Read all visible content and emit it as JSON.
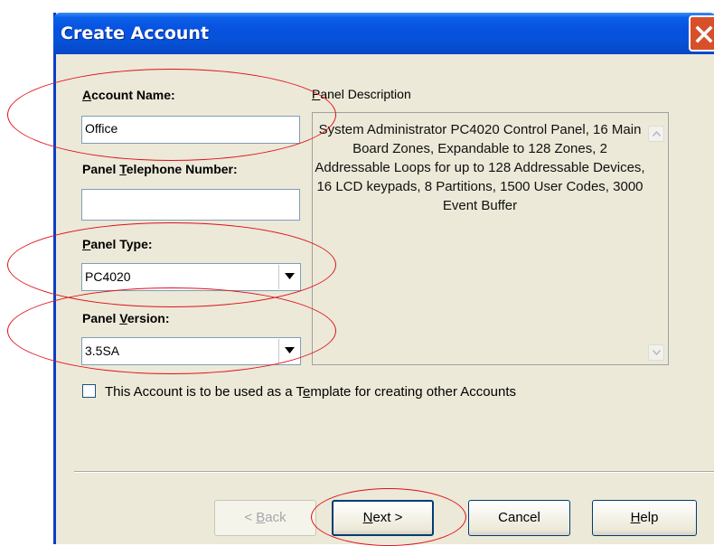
{
  "window": {
    "title": "Create Account"
  },
  "form": {
    "account_name_label_pre": "",
    "account_name_label_u": "A",
    "account_name_label_post": "ccount Name:",
    "account_name_value": "Office",
    "phone_label_pre": "Panel ",
    "phone_label_u": "T",
    "phone_label_post": "elephone Number:",
    "phone_value": "",
    "panel_type_label_pre": "",
    "panel_type_label_u": "P",
    "panel_type_label_post": "anel Type:",
    "panel_type_value": "PC4020",
    "panel_version_label_pre": "Panel ",
    "panel_version_label_u": "V",
    "panel_version_label_post": "ersion:",
    "panel_version_value": "3.5SA",
    "description_label_pre": "",
    "description_label_u": "P",
    "description_label_post": "anel Description",
    "description_text": "System Administrator PC4020 Control Panel, 16 Main Board Zones, Expandable to 128 Zones, 2 Addressable Loops for up to 128 Addressable Devices, 16 LCD keypads, 8 Partitions, 1500 User Codes, 3000 Event Buffer",
    "template_label_pre": "This Account is to be used as a T",
    "template_label_u": "e",
    "template_label_post": "mplate for creating other Accounts",
    "template_checked": false
  },
  "buttons": {
    "back_pre": "< ",
    "back_u": "B",
    "back_post": "ack",
    "next_pre": "",
    "next_u": "N",
    "next_post": "ext >",
    "cancel": "Cancel",
    "help_pre": "",
    "help_u": "H",
    "help_post": "elp"
  },
  "colors": {
    "annotation": "#e0101a",
    "title_bar": "#0752e0",
    "dialog_bg": "#ece9d8"
  }
}
